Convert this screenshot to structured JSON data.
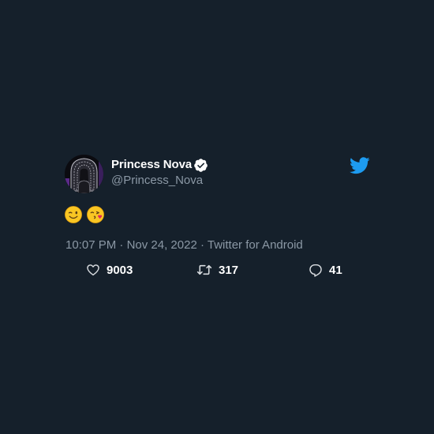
{
  "tweet": {
    "display_name": "Princess Nova",
    "handle": "@Princess_Nova",
    "verified": true,
    "emoji": [
      "winking-face",
      "face-blowing-a-kiss"
    ],
    "time": "10:07 PM",
    "date": "Nov 24, 2022",
    "source": "Twitter for Android",
    "separator": "·"
  },
  "actions": {
    "likes": "9003",
    "retweets": "317",
    "replies": "41"
  },
  "icons": {
    "brand": "twitter-bird-icon",
    "verified": "verified-badge-icon",
    "like": "heart-icon",
    "retweet": "retweet-icon",
    "reply": "reply-icon"
  },
  "colors": {
    "background": "#15202b",
    "name": "#ffffff",
    "secondary_text": "#8b98a5",
    "twitter_blue": "#1d9bf0"
  }
}
